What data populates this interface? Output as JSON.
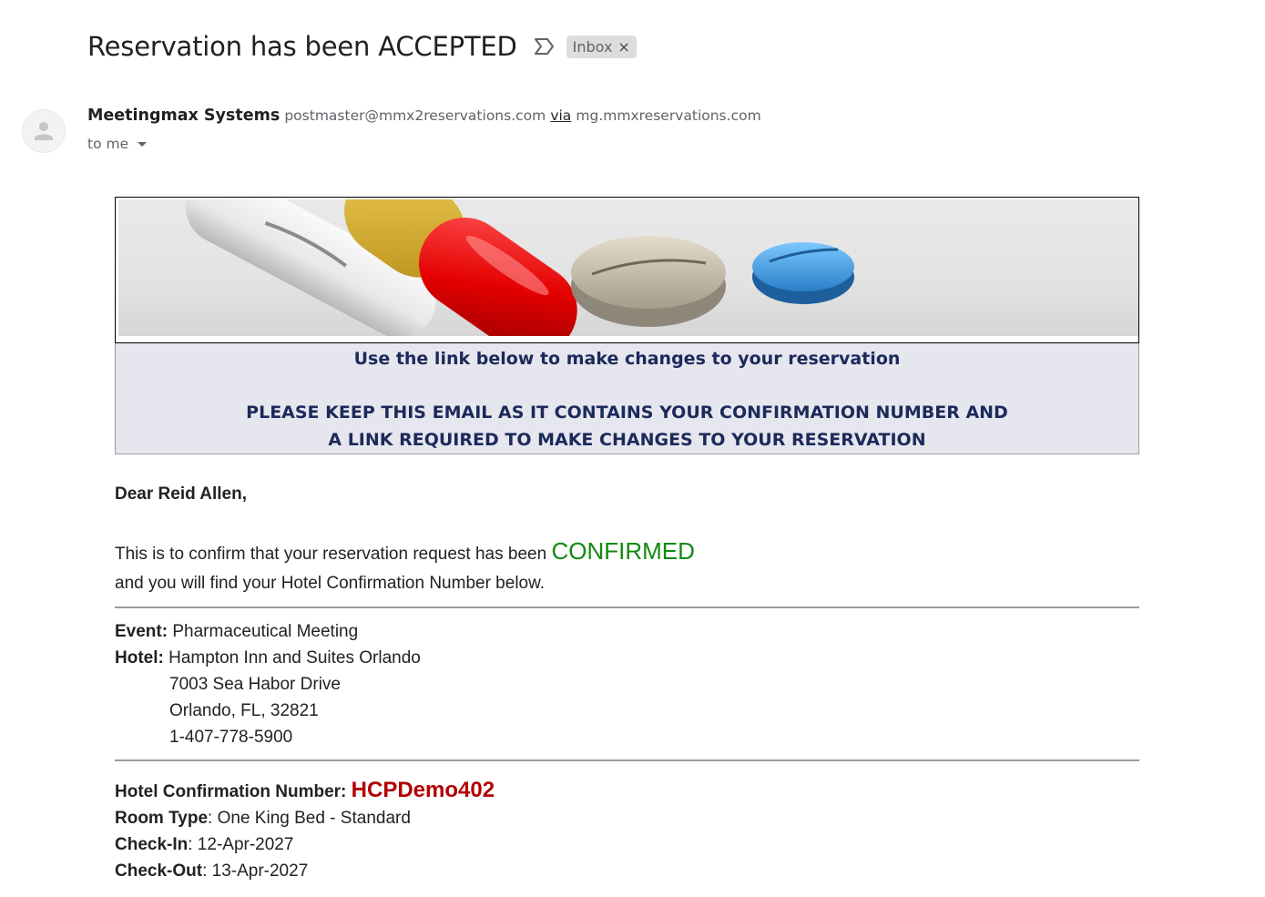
{
  "subject": "Reservation has been ACCEPTED",
  "label_chip": {
    "text": "Inbox",
    "close": "×"
  },
  "sender": {
    "name": "Meetingmax Systems",
    "email": "postmaster@mmx2reservations.com",
    "via": "via",
    "domain": "mg.mmxreservations.com",
    "to": "to me"
  },
  "notice": {
    "line1": "Use the link below to make changes to your reservation",
    "line2": "PLEASE KEEP THIS EMAIL AS IT CONTAINS YOUR CONFIRMATION NUMBER AND",
    "line3": "A LINK REQUIRED TO MAKE CHANGES TO YOUR RESERVATION"
  },
  "letter": {
    "greeting": "Dear Reid Allen,",
    "confirm_text": "This is to confirm that your reservation request has been",
    "confirm_status": "CONFIRMED",
    "confirm_text2": "and you will find your Hotel Confirmation Number below."
  },
  "event": {
    "label": "Event:",
    "value": "Pharmaceutical Meeting"
  },
  "hotel": {
    "label": "Hotel:",
    "name": "Hampton Inn and Suites Orlando",
    "street": "7003 Sea Habor Drive",
    "city": "Orlando, FL, 32821",
    "phone": "1-407-778-5900"
  },
  "reservation": {
    "conf_label": "Hotel Confirmation Number:",
    "conf_number": "HCPDemo402",
    "room_label": "Room Type",
    "room_value": ": One King Bed - Standard",
    "checkin_label": "Check-In",
    "checkin_value": ": 12-Apr-2027",
    "checkout_label": "Check-Out",
    "checkout_value": ": 13-Apr-2027"
  },
  "colors": {
    "confirmed": "#118a11",
    "conf_number": "#b20000",
    "notice_text": "#1c2a5a",
    "notice_bg": "#e6e6ef"
  },
  "icons": {
    "important": "important-marker-icon",
    "avatar": "default-avatar-icon",
    "caret": "caret-down-icon",
    "banner": "pills-banner-image"
  }
}
